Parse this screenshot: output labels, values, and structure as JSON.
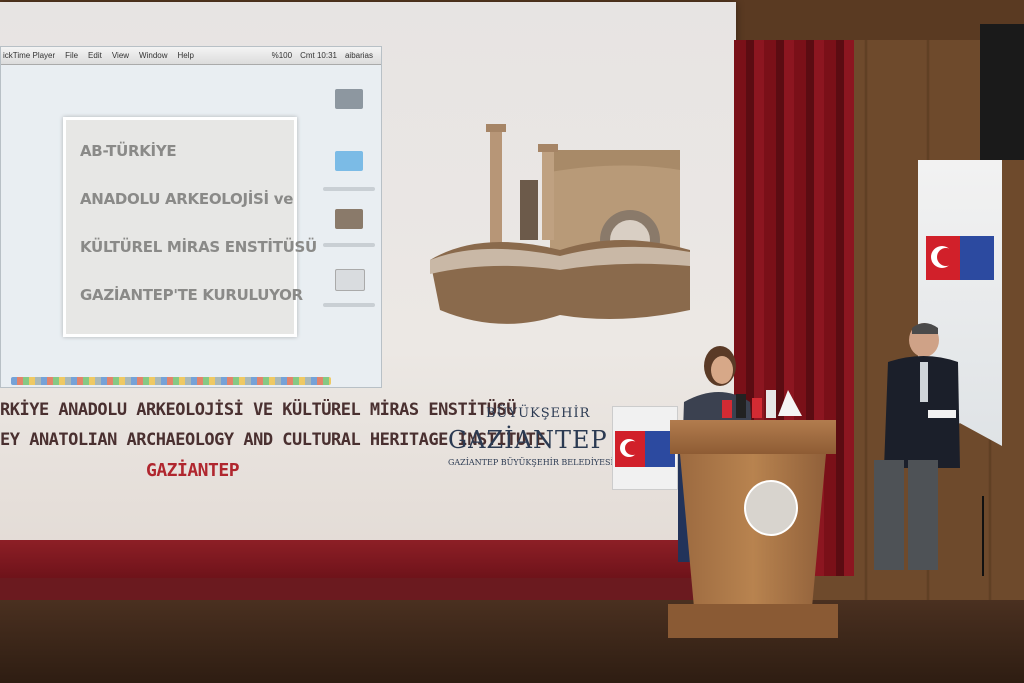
{
  "laptop_menubar": {
    "items": [
      "ickTime Player",
      "File",
      "Edit",
      "View",
      "Window",
      "Help"
    ],
    "status": [
      "%100",
      "Cmt 10:31",
      "aibarias"
    ]
  },
  "slide": {
    "lines": [
      "AB-TÜRKİYE",
      "ANADOLU ARKEOLOJİSİ ve",
      "KÜLTÜREL MİRAS ENSTİTÜSÜ",
      "GAZİANTEP'TE KURULUYOR"
    ]
  },
  "screen_title": {
    "turkish": "RKİYE ANADOLU  ARKEOLOJİSİ VE KÜLTÜREL MİRAS ENSTİTÜSÜ",
    "english": "EY ANATOLIAN ARCHAEOLOGY AND CULTURAL HERITAGE INSTITUTE",
    "city": "GAZİANTEP"
  },
  "logo": {
    "top": "BÜYÜKŞEHİR",
    "main": "GAZİANTEP",
    "sub": "GAZİANTEP BÜYÜKŞEHİR BELEDİYESİ"
  },
  "colors": {
    "title_dark": "#4a3030",
    "city_red": "#b0262e",
    "curtain": "#7a1018",
    "eu_blue": "#2c4aa0",
    "turkey_red": "#d1202a"
  }
}
